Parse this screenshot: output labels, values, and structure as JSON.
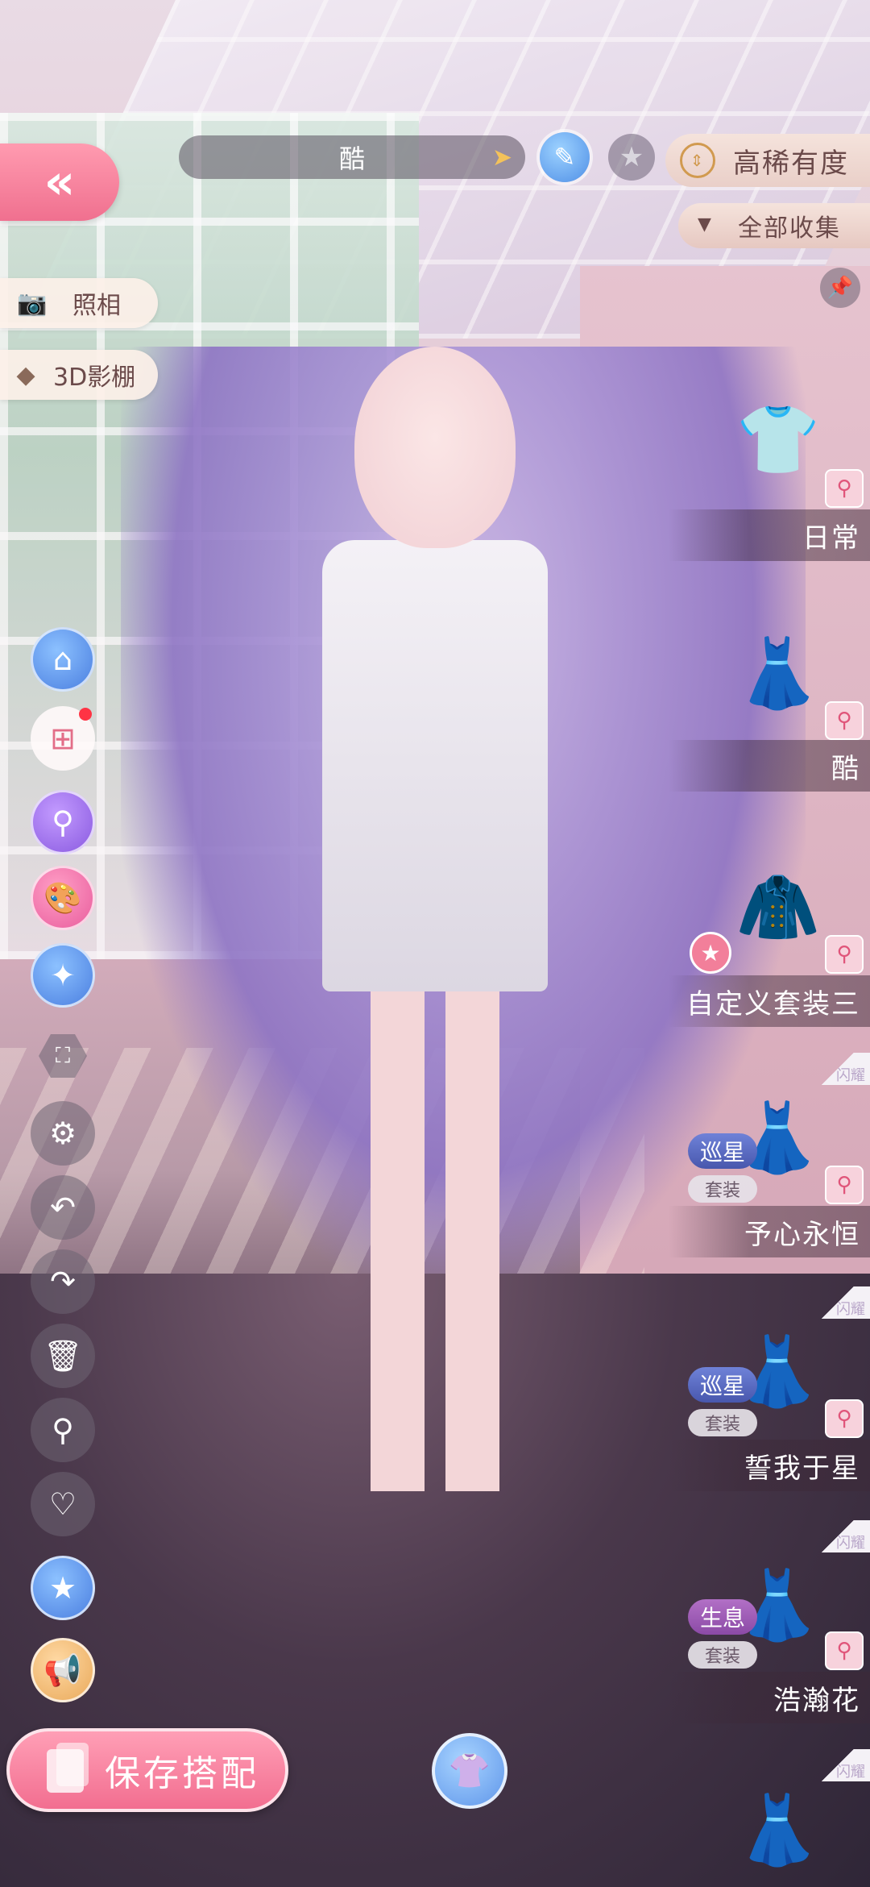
{
  "header": {
    "outfit_name": "酷",
    "sort_label": "高稀有度",
    "filter_label": "全部收集"
  },
  "left_menu": {
    "photo_label": "照相",
    "studio_label": "3D影棚"
  },
  "bottom": {
    "save_label": "保存搭配"
  },
  "wardrobe": {
    "items": [
      {
        "name": "日常",
        "thumb": "👕"
      },
      {
        "name": "酷",
        "thumb": "👗"
      },
      {
        "name": "自定义套装三",
        "thumb": "🧥"
      },
      {
        "name": "予心永恒",
        "thumb": "👗",
        "tag": "巡星",
        "set": "套装",
        "corner": "闪耀"
      },
      {
        "name": "誓我于星",
        "thumb": "👗",
        "tag": "巡星",
        "set": "套装",
        "corner": "闪耀"
      },
      {
        "name": "浩瀚花",
        "thumb": "👗",
        "tag": "生息",
        "set": "套装",
        "corner": "闪耀"
      },
      {
        "name": "",
        "thumb": "👗",
        "corner": "闪耀"
      }
    ]
  },
  "icons": {
    "back": "double-chevron-left",
    "pen": "pencil",
    "star": "star",
    "pin": "pin",
    "settings": "gear",
    "undo": "undo",
    "redo": "redo",
    "delete": "trash",
    "search": "magnifier",
    "favorite": "heart",
    "broadcast": "megaphone"
  },
  "colors": {
    "accent_pink": "#f26e90",
    "tag_star": "#4857ad",
    "tag_life": "#8b4aa6"
  }
}
